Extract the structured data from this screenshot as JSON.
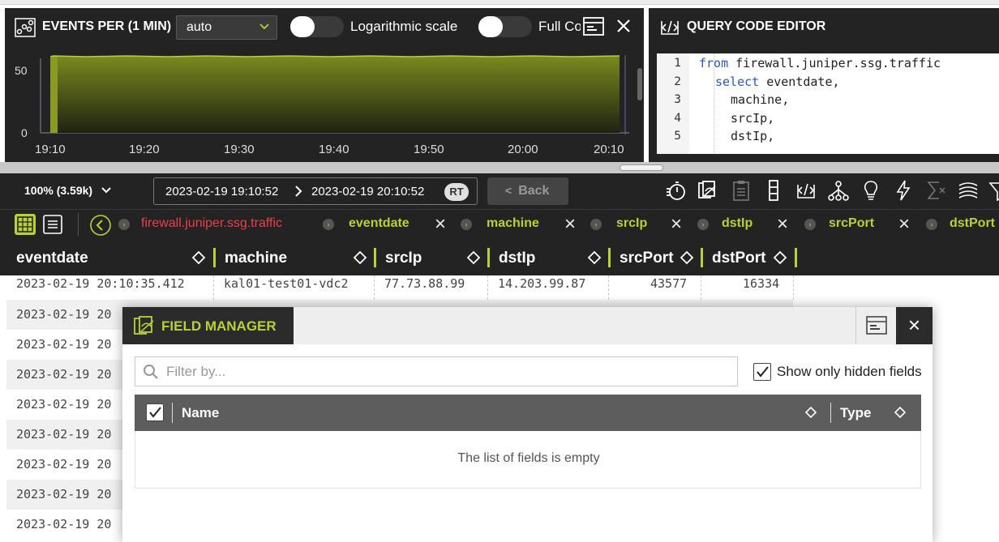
{
  "chart": {
    "title": "EVENTS PER (1 MIN)",
    "interval": "auto",
    "log_label": "Logarithmic scale",
    "full_label": "Full Co",
    "y_ticks": [
      "50",
      "0"
    ],
    "x_ticks": [
      "19:10",
      "19:20",
      "19:30",
      "19:40",
      "19:50",
      "20:00",
      "20:10"
    ]
  },
  "editor": {
    "title": "QUERY CODE EDITOR",
    "line_numbers": [
      "1",
      "2",
      "3",
      "4",
      "5"
    ],
    "lines": [
      {
        "kw": "from",
        "text": " firewall.juniper.ssg.traffic"
      },
      {
        "kw": "select",
        "text": " eventdate,"
      },
      {
        "kw": "",
        "text": "machine,"
      },
      {
        "kw": "",
        "text": "srcIp,"
      },
      {
        "kw": "",
        "text": "dstIp,"
      }
    ]
  },
  "toolbar": {
    "zoom": "100% (3.59k)",
    "from": "2023-02-19 19:10:52",
    "to": "2023-02-19 20:10:52",
    "rt": "RT",
    "back": "Back"
  },
  "pipeline": {
    "source": "firewall.juniper.ssg.traffic",
    "fields": [
      "eventdate",
      "machine",
      "srcIp",
      "dstIp",
      "srcPort",
      "dstPort"
    ]
  },
  "table": {
    "columns": [
      "eventdate",
      "machine",
      "srcIp",
      "dstIp",
      "srcPort",
      "dstPort"
    ],
    "first_row": [
      "2023-02-19 20:10:35.412",
      "kal01-test01-vdc2",
      "77.73.88.99",
      "14.203.99.87",
      "43577",
      "16334"
    ],
    "partial_rows": [
      "2023-02-19 20",
      "2023-02-19 20",
      "2023-02-19 20",
      "2023-02-19 20",
      "2023-02-19 20",
      "2023-02-19 20",
      "2023-02-19 20",
      "2023-02-19 20"
    ]
  },
  "field_manager": {
    "title": "FIELD MANAGER",
    "filter_placeholder": "Filter by...",
    "show_hidden_label": "Show only hidden fields",
    "col_name": "Name",
    "col_type": "Type",
    "empty": "The list of fields is empty"
  },
  "colors": {
    "accent": "#b8d232",
    "source_red": "#e8414a",
    "panel_bg": "#232323"
  }
}
